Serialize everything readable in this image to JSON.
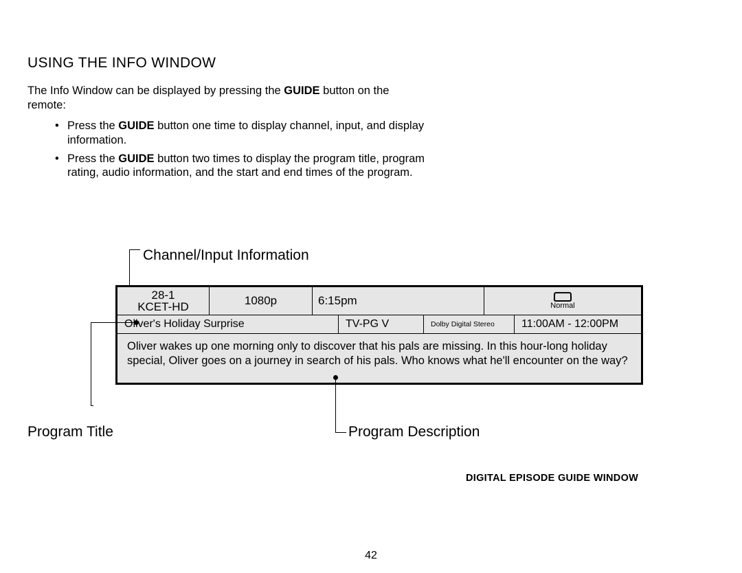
{
  "heading": "USING THE INFO WINDOW",
  "intro_parts": {
    "a": "The Info Window can be displayed by pressing the ",
    "b": "GUIDE",
    "c": " button on the remote:"
  },
  "bullets": [
    {
      "a": "Press the ",
      "b": "GUIDE",
      "c": " button one time to display channel, input, and display information."
    },
    {
      "a": "Press the ",
      "b": "GUIDE",
      "c": " button two times to display the program title, program rating, audio information, and the start and end times of the program."
    }
  ],
  "callouts": {
    "channel_info": "Channel/Input Information",
    "program_title": "Program Title",
    "program_description": "Program Description"
  },
  "info": {
    "channel_number": "28-1",
    "channel_name": "KCET-HD",
    "resolution": "1080p",
    "clock": "6:15pm",
    "aspect_mode": "Normal",
    "program_title": "Oliver's Holiday Surprise",
    "rating": "TV-PG V",
    "audio": "Dolby Digital Stereo",
    "times": "11:00AM - 12:00PM",
    "description": "Oliver wakes up one morning only to discover that his pals are missing. In this hour-long holiday special, Oliver goes on a journey in search of his pals. Who knows what he'll encounter on the way?"
  },
  "caption": "DIGITAL EPISODE GUIDE WINDOW",
  "page_number": "42",
  "bullet_glyph": "•"
}
